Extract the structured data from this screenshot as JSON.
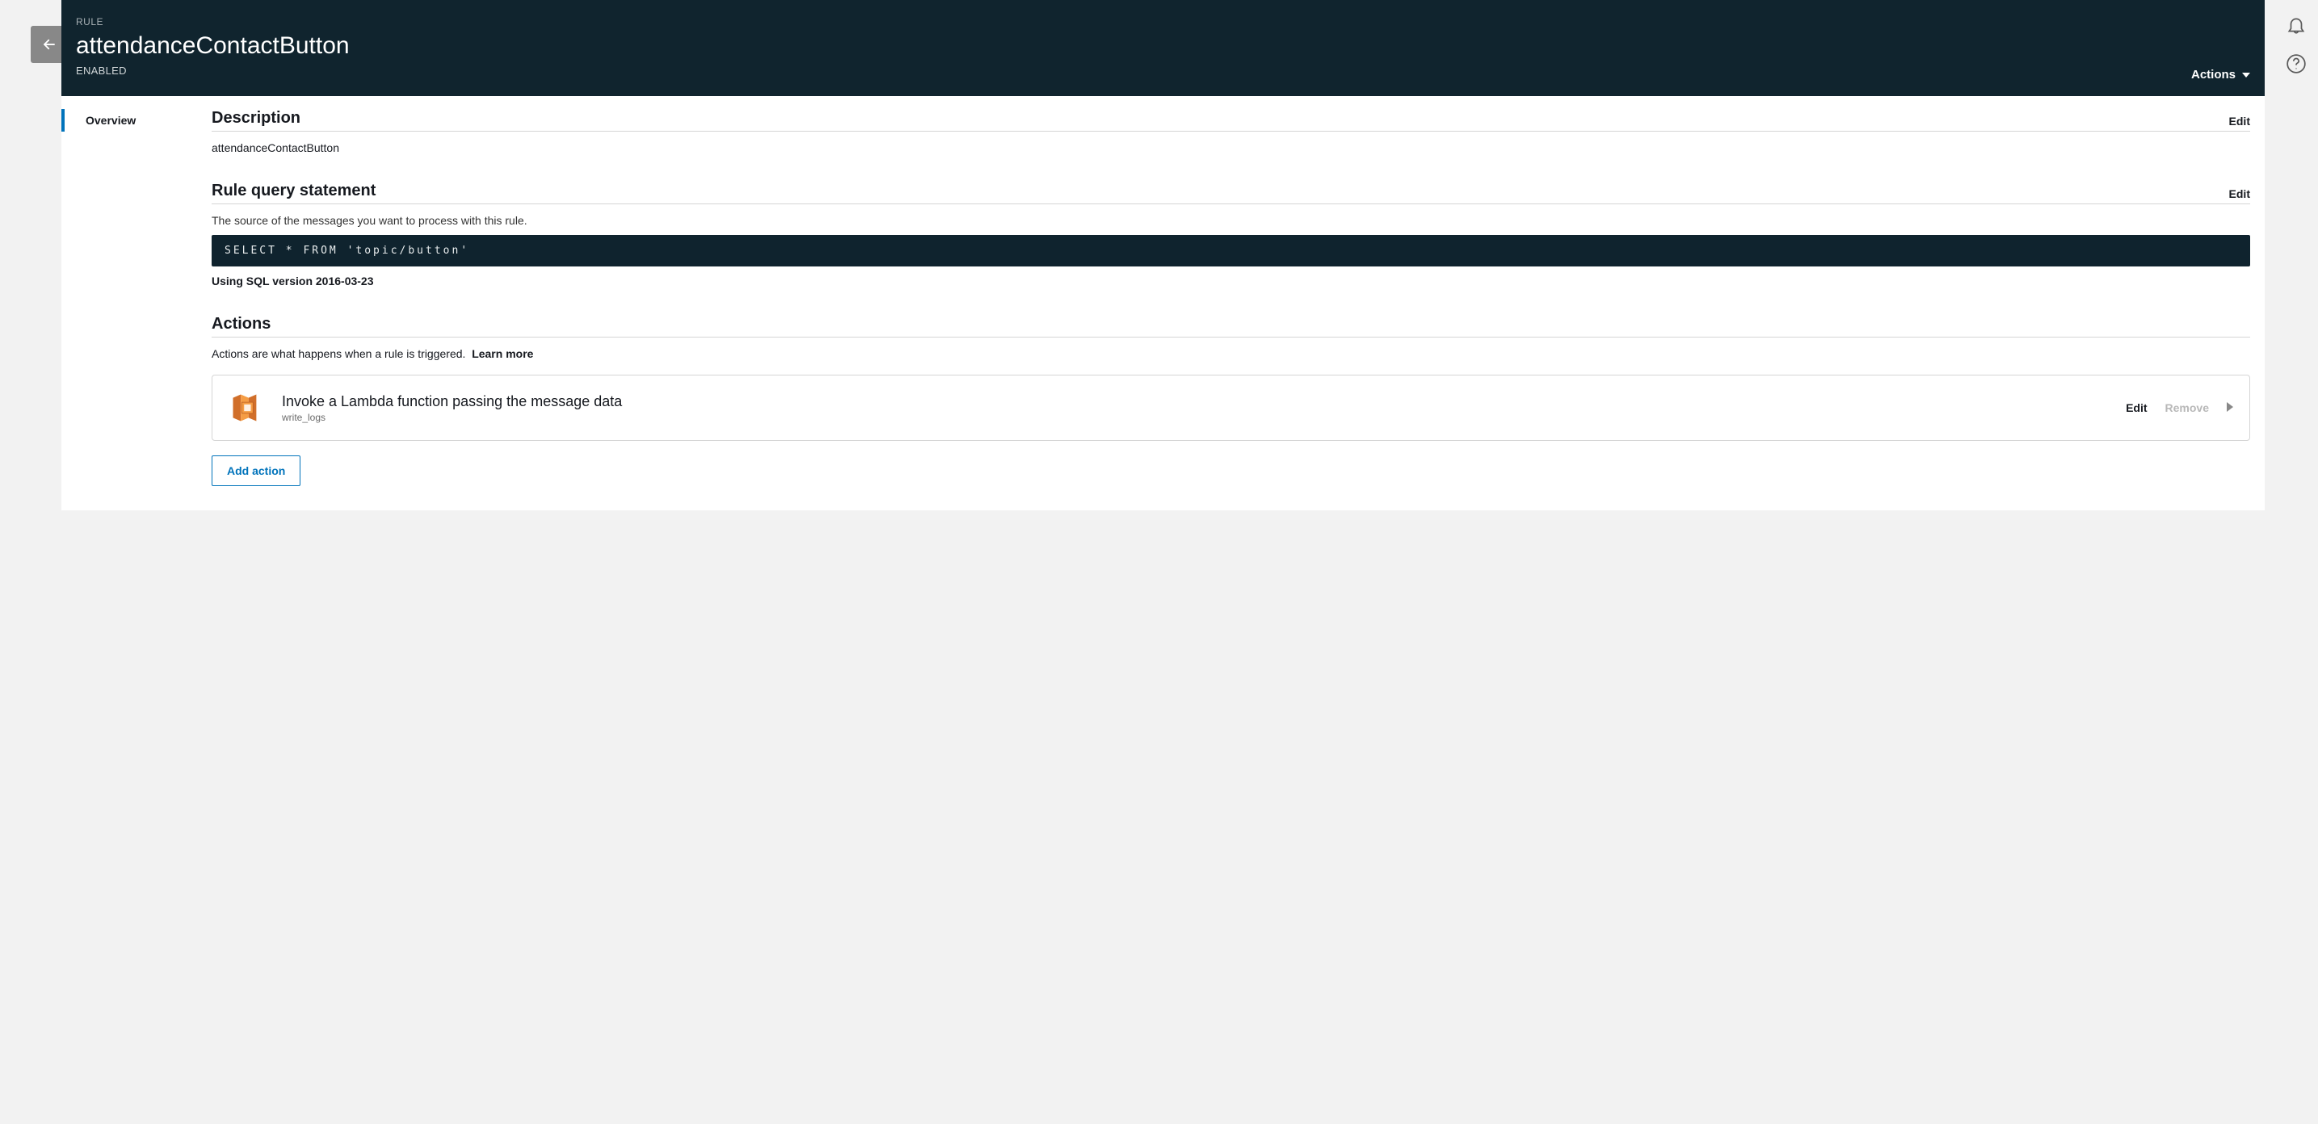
{
  "header": {
    "eyebrow": "RULE",
    "title": "attendanceContactButton",
    "status": "ENABLED",
    "actions_label": "Actions"
  },
  "sidebar": {
    "tab_overview": "Overview"
  },
  "description": {
    "heading": "Description",
    "edit": "Edit",
    "text": "attendanceContactButton"
  },
  "query": {
    "heading": "Rule query statement",
    "edit": "Edit",
    "helper": "The source of the messages you want to process with this rule.",
    "sql": "SELECT * FROM 'topic/button'",
    "sql_version": "Using SQL version 2016-03-23"
  },
  "actions": {
    "heading": "Actions",
    "helper": "Actions are what happens when a rule is triggered.",
    "learn_more": "Learn more",
    "items": [
      {
        "title": "Invoke a Lambda function passing the message data",
        "subtitle": "write_logs",
        "edit": "Edit",
        "remove": "Remove"
      }
    ],
    "add_label": "Add action"
  }
}
